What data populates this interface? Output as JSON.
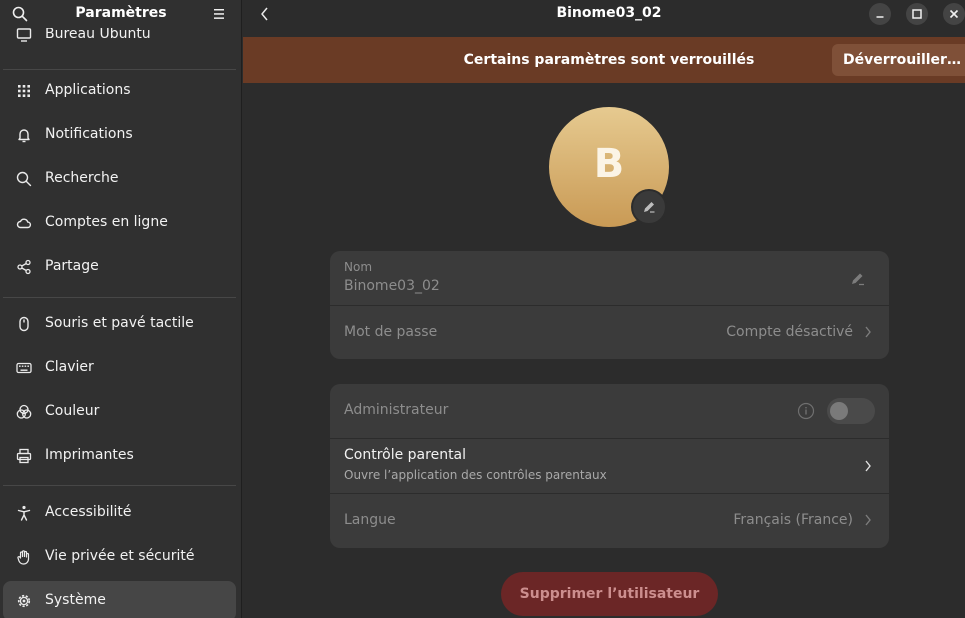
{
  "sidebar": {
    "title": "Paramètres",
    "partial_item": "Bureau Ubuntu",
    "items": [
      {
        "label": "Applications",
        "icon": "grid-icon"
      },
      {
        "label": "Notifications",
        "icon": "bell-icon"
      },
      {
        "label": "Recherche",
        "icon": "search-icon"
      },
      {
        "label": "Comptes en ligne",
        "icon": "cloud-icon"
      },
      {
        "label": "Partage",
        "icon": "share-icon"
      },
      {
        "label": "Souris et pavé tactile",
        "icon": "mouse-icon"
      },
      {
        "label": "Clavier",
        "icon": "keyboard-icon"
      },
      {
        "label": "Couleur",
        "icon": "color-icon"
      },
      {
        "label": "Imprimantes",
        "icon": "printer-icon"
      },
      {
        "label": "Accessibilité",
        "icon": "accessibility-icon"
      },
      {
        "label": "Vie privée et sécurité",
        "icon": "hand-icon"
      },
      {
        "label": "Système",
        "icon": "gear-icon",
        "active": true
      }
    ]
  },
  "header": {
    "title": "Binome03_02"
  },
  "banner": {
    "text": "Certains paramètres sont verrouillés",
    "unlock_label": "Déverrouiller…"
  },
  "user": {
    "avatar_letter": "B",
    "name_caption": "Nom",
    "name_value": "Binome03_02",
    "password_label": "Mot de passe",
    "password_value": "Compte désactivé",
    "admin_label": "Administrateur",
    "admin_enabled": false,
    "parental_title": "Contrôle parental",
    "parental_subtitle": "Ouvre l’application des contrôles parentaux",
    "language_label": "Langue",
    "language_value": "Français (France)"
  },
  "actions": {
    "delete_label": "Supprimer l’utilisateur"
  },
  "colors": {
    "banner": "#6a3b25",
    "delete_button": "#6b2626",
    "avatar_top": "#e6ca90",
    "avatar_bottom": "#c99a55"
  }
}
